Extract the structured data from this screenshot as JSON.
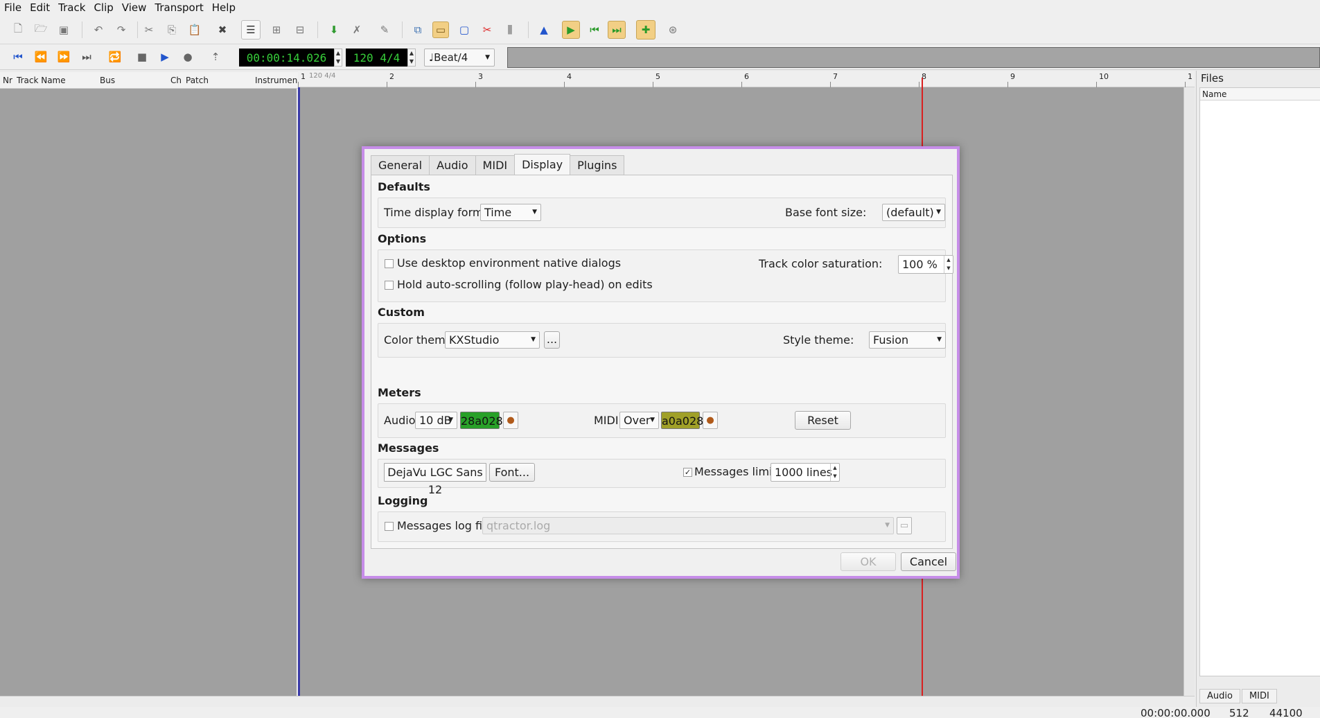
{
  "menu": [
    "File",
    "Edit",
    "Track",
    "Clip",
    "View",
    "Transport",
    "Help"
  ],
  "transport": {
    "time": "00:00:14.026",
    "tempo": "120 4/4",
    "snap": "♩Beat/4"
  },
  "track_columns": [
    "Nr",
    "Track Name",
    "Bus",
    "Ch",
    "Patch",
    "Instrumen"
  ],
  "ruler": {
    "signature": "120 4/4",
    "bars": [
      "1",
      "2",
      "3",
      "4",
      "5",
      "6",
      "7",
      "8",
      "9",
      "10",
      "1"
    ]
  },
  "files": {
    "title": "Files",
    "column": "Name",
    "tabs": [
      "Audio",
      "MIDI"
    ]
  },
  "status": {
    "time": "00:00:00.000",
    "buffer": "512",
    "rate": "44100"
  },
  "dialog": {
    "tabs": [
      "General",
      "Audio",
      "MIDI",
      "Display",
      "Plugins"
    ],
    "selected_tab": "Display",
    "defaults": {
      "title": "Defaults",
      "time_format_label": "Time display format:",
      "time_format_value": "Time",
      "font_size_label": "Base font size:",
      "font_size_value": "(default)"
    },
    "options": {
      "title": "Options",
      "native_dialogs": "Use desktop environment native dialogs",
      "hold_autoscroll": "Hold auto-scrolling (follow play-head) on edits",
      "saturation_label": "Track color saturation:",
      "saturation_value": "100 %"
    },
    "custom": {
      "title": "Custom",
      "color_theme_label": "Color theme:",
      "color_theme_value": "KXStudio",
      "more_button": "...",
      "style_theme_label": "Style theme:",
      "style_theme_value": "Fusion"
    },
    "meters": {
      "title": "Meters",
      "audio_label": "Audio:",
      "audio_level": "10 dB",
      "audio_color": "28a028",
      "midi_label": "MIDI:",
      "midi_level": "Over",
      "midi_color": "a0a028",
      "reset": "Reset"
    },
    "messages": {
      "title": "Messages",
      "font_value": "DejaVu LGC Sans 12",
      "font_button": "Font...",
      "limit_label": "Messages limit:",
      "limit_value": "1000 lines"
    },
    "logging": {
      "title": "Logging",
      "log_label": "Messages log file:",
      "log_value": "qtractor.log"
    },
    "ok": "OK",
    "cancel": "Cancel"
  },
  "colors": {
    "meter_audio": "#28a028",
    "meter_midi": "#a0a028",
    "dialog_border": "#c68de8",
    "playhead": "#d92020"
  }
}
